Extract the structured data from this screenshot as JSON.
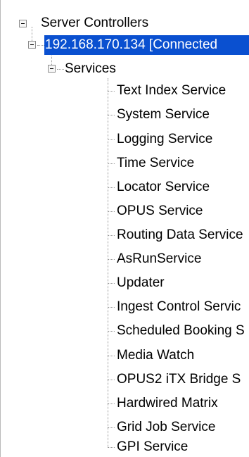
{
  "tree": {
    "root": {
      "label": "Server Controllers",
      "expanded": true
    },
    "server": {
      "label": "192.168.170.134 [Connected",
      "expanded": true,
      "selected": true
    },
    "services": {
      "label": "Services",
      "expanded": true
    },
    "items": [
      {
        "label": "Text Index Service"
      },
      {
        "label": "System Service"
      },
      {
        "label": "Logging Service"
      },
      {
        "label": "Time Service"
      },
      {
        "label": "Locator Service"
      },
      {
        "label": "OPUS Service"
      },
      {
        "label": "Routing Data Service"
      },
      {
        "label": "AsRunService"
      },
      {
        "label": "Updater"
      },
      {
        "label": "Ingest Control Servic"
      },
      {
        "label": "Scheduled Booking S"
      },
      {
        "label": "Media Watch"
      },
      {
        "label": "OPUS2 iTX Bridge S"
      },
      {
        "label": "Hardwired Matrix"
      },
      {
        "label": "Grid Job Service"
      },
      {
        "label": "GPI Service"
      }
    ]
  },
  "colors": {
    "selection": "#0a50d0",
    "tree_lines": "#9a9a9a"
  }
}
